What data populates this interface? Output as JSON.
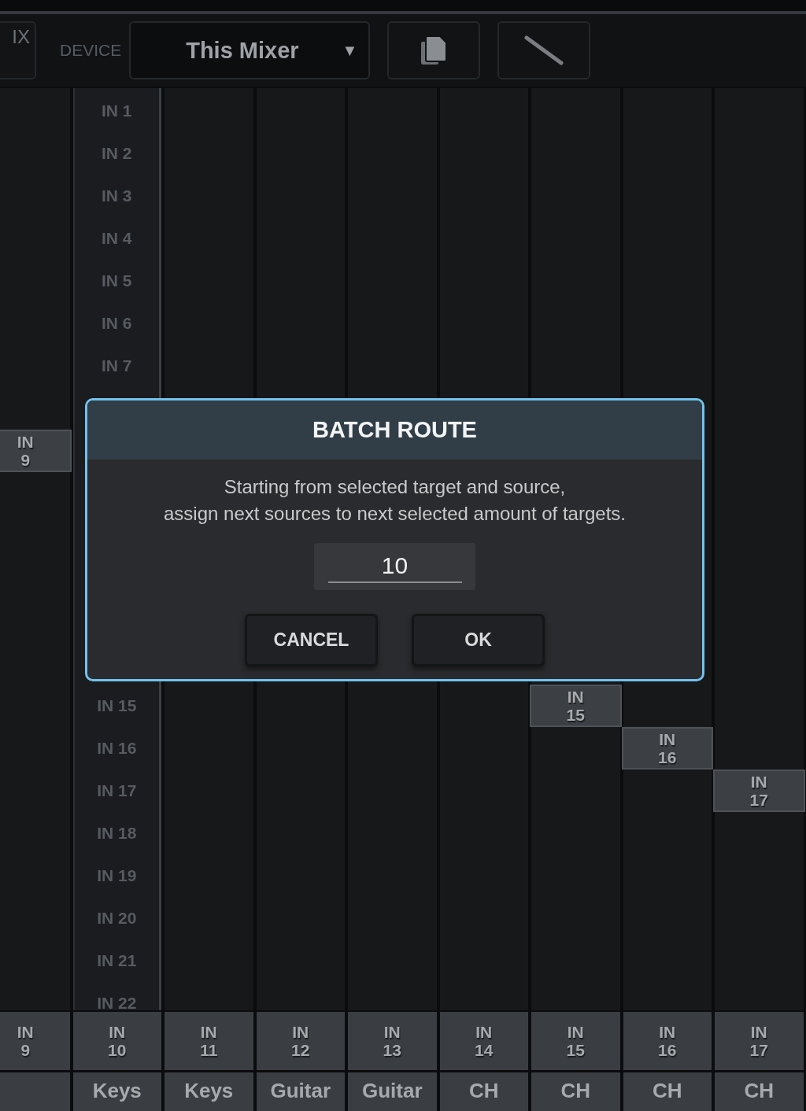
{
  "toolbar": {
    "mode_button": "IX",
    "device_label": "DEVICE",
    "device_select": {
      "value": "This Mixer",
      "arrow": "▼"
    }
  },
  "grid": {
    "sources_above": [
      "IN 1",
      "IN 2",
      "IN 3",
      "IN 4",
      "IN 5",
      "IN 6",
      "IN 7"
    ],
    "sources_below": [
      "IN 15",
      "IN 16",
      "IN 17",
      "IN 18",
      "IN 19",
      "IN 20",
      "IN 21",
      "IN 22"
    ],
    "columns": [
      {
        "selected": false,
        "label": "IN 9"
      },
      {
        "selected": true
      },
      {
        "selected": false
      },
      {
        "selected": false
      },
      {
        "selected": false
      },
      {
        "selected": false
      },
      {
        "selected": false,
        "label": "IN 15"
      },
      {
        "selected": false,
        "label": "IN 16"
      },
      {
        "selected": false,
        "label": "IN 17"
      }
    ]
  },
  "footer": [
    {
      "input": "IN 9"
    },
    {
      "input": "IN 10",
      "name": "Keys"
    },
    {
      "input": "IN 11",
      "name": "Keys"
    },
    {
      "input": "IN 12",
      "name": "Guitar"
    },
    {
      "input": "IN 13",
      "name": "Guitar"
    },
    {
      "input": "IN 14",
      "name": "CH"
    },
    {
      "input": "IN 15",
      "name": "CH"
    },
    {
      "input": "IN 16",
      "name": "CH"
    },
    {
      "input": "IN 17",
      "name": "CH"
    }
  ],
  "dialog": {
    "title": "BATCH ROUTE",
    "message": "Starting from selected target and source,\nassign next sources to next selected amount of targets.",
    "amount": "10",
    "buttons": [
      "CANCEL",
      "OK"
    ]
  }
}
